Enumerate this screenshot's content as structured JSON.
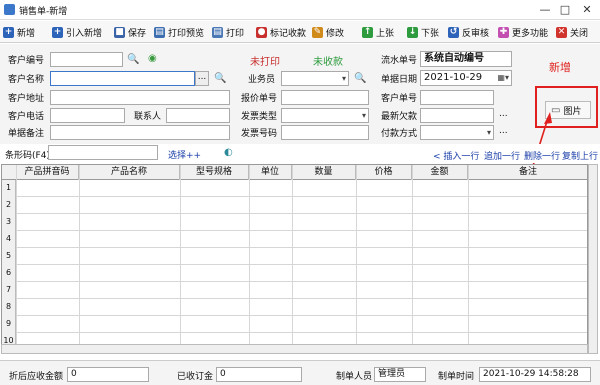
{
  "window": {
    "title": "销售单-新增",
    "controls": [
      "—",
      "□",
      "✕"
    ]
  },
  "toolbar": [
    {
      "name": "toolbar-new-button",
      "label": "新增",
      "icon": "plus-icon",
      "color": "#2d63b8",
      "glyph": "+"
    },
    {
      "name": "toolbar-import-new-button",
      "label": "引入新增",
      "icon": "plus-icon",
      "color": "#2d63b8",
      "glyph": "+"
    },
    {
      "name": "toolbar-save-button",
      "label": "保存",
      "icon": "save-icon",
      "color": "#3a63a8",
      "glyph": "■"
    },
    {
      "name": "toolbar-print-preview-button",
      "label": "打印预览",
      "icon": "print-preview-icon",
      "color": "#3d6fb0",
      "glyph": "▤"
    },
    {
      "name": "toolbar-print-button",
      "label": "打印",
      "icon": "printer-icon",
      "color": "#4c78b5",
      "glyph": "▤"
    },
    {
      "name": "toolbar-mark-payment-button",
      "label": "标记收款",
      "icon": "mark-icon",
      "color": "#c8302e",
      "glyph": "●"
    },
    {
      "name": "toolbar-edit-button",
      "label": "修改",
      "icon": "edit-icon",
      "color": "#d08a1a",
      "glyph": "✎"
    },
    {
      "name": "toolbar-prev-button",
      "label": "上张",
      "icon": "up-icon",
      "color": "#2e9b3e",
      "glyph": "↑"
    },
    {
      "name": "toolbar-next-button",
      "label": "下张",
      "icon": "down-icon",
      "color": "#2e9b3e",
      "glyph": "↓"
    },
    {
      "name": "toolbar-unaudit-button",
      "label": "反审核",
      "icon": "unaudit-icon",
      "color": "#2d63b8",
      "glyph": "↺"
    },
    {
      "name": "toolbar-more-button",
      "label": "更多功能",
      "icon": "more-icon",
      "color": "#c34fb0",
      "glyph": "✚"
    },
    {
      "name": "toolbar-close-button",
      "label": "关闭",
      "icon": "close-icon",
      "color": "#d0342c",
      "glyph": "✕"
    }
  ],
  "form": {
    "customer_code_label": "客户编号",
    "customer_name_label": "客户名称",
    "customer_address_label": "客户地址",
    "customer_phone_label": "客户电话",
    "contact_label": "联系人",
    "remark_label": "单据备注",
    "print_status": "未打印",
    "collect_status": "未收款",
    "salesman_label": "业务员",
    "quote_no_label": "报价单号",
    "invoice_type_label": "发票类型",
    "invoice_no_label": "发票号码",
    "serial_no_label": "流水单号",
    "serial_no_value": "系统自动编号",
    "doc_date_label": "单据日期",
    "doc_date_value": "2021-10-29",
    "customer_doc_no_label": "客户单号",
    "latest_debt_label": "最新欠款",
    "payment_method_label": "付款方式",
    "ellipsis": "...",
    "picture_button": "图片"
  },
  "barcode": {
    "label": "条形码(F4)",
    "select_link": "选择++",
    "row_actions": [
      "< 插入一行",
      "追加一行",
      "删除一行",
      "复制上行"
    ]
  },
  "grid": {
    "columns": [
      "产品拼音码",
      "产品名称",
      "型号规格",
      "单位",
      "数量",
      "价格",
      "金额",
      "备注"
    ],
    "rows": [
      "1",
      "2",
      "3",
      "4",
      "5",
      "6",
      "7",
      "8",
      "9",
      "10"
    ]
  },
  "footer": {
    "discount_receivable_label": "折后应收金额",
    "discount_receivable_value": "0",
    "deposit_label": "已收订金",
    "deposit_value": "0",
    "maker_label": "制单人员",
    "maker_value": "管理员",
    "make_time_label": "制单时间",
    "make_time_value": "2021-10-29 14:58:28"
  },
  "annotation": {
    "text": "新增",
    "color": "#e0201e"
  }
}
